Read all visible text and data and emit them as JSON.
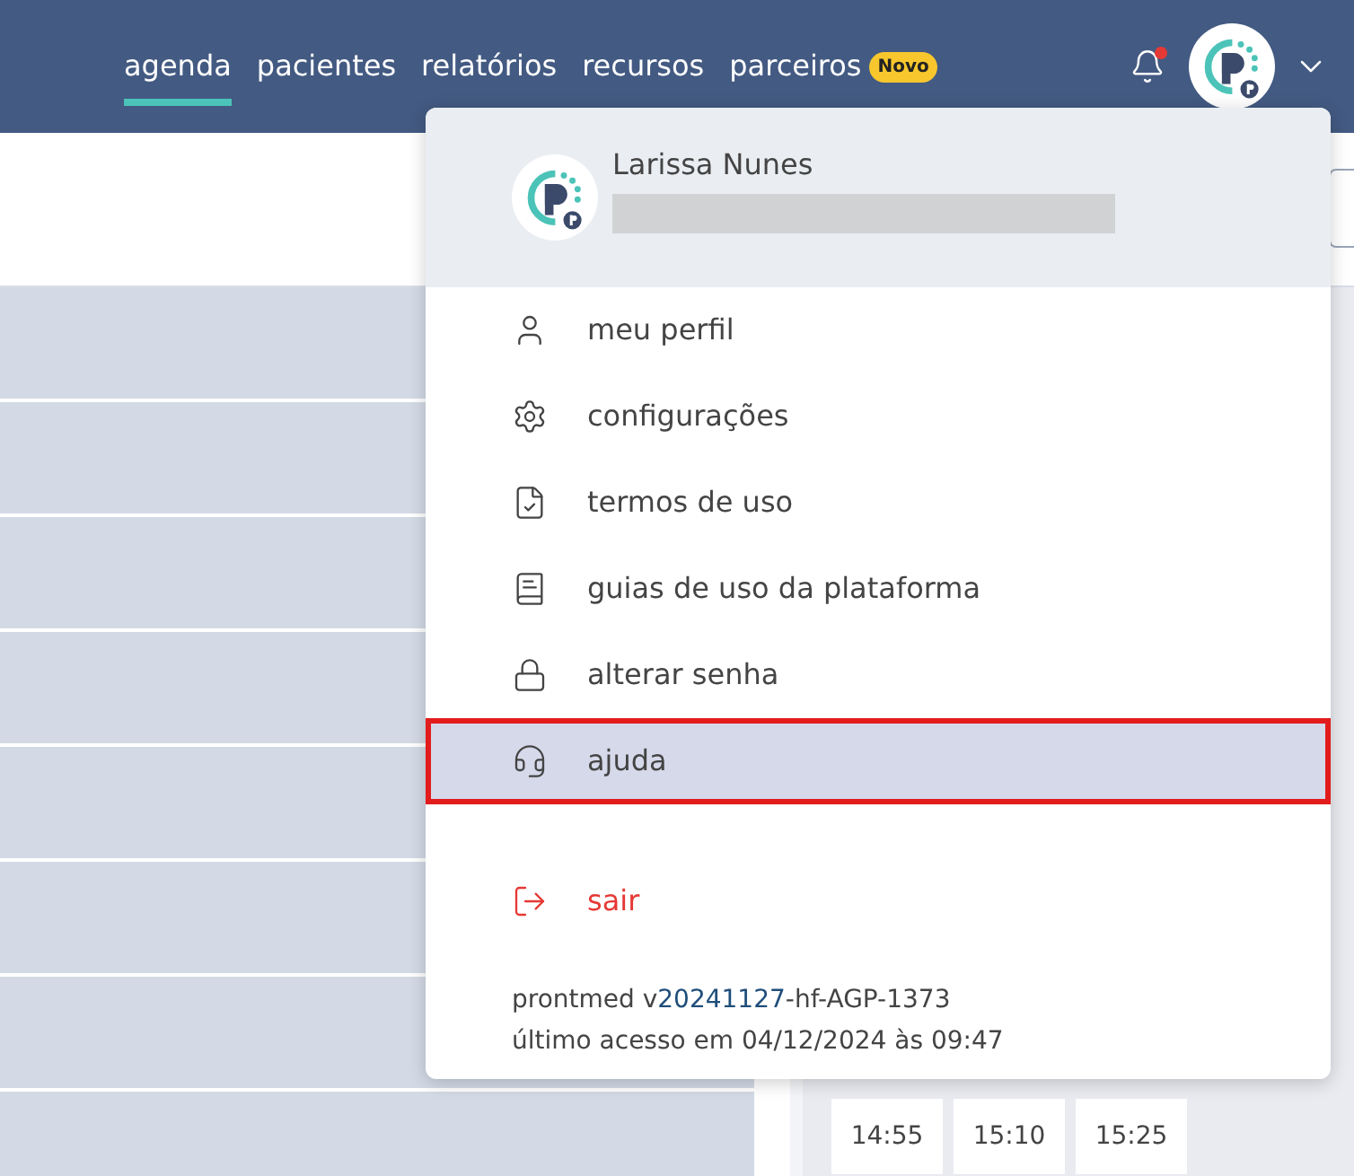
{
  "nav": {
    "items": [
      {
        "label": "agenda",
        "selected": true
      },
      {
        "label": "pacientes",
        "selected": false
      },
      {
        "label": "relatórios",
        "selected": false
      },
      {
        "label": "recursos",
        "selected": false
      },
      {
        "label": "parceiros",
        "selected": false,
        "badge": "Novo"
      }
    ],
    "notifications": {
      "unread": true
    }
  },
  "user_menu": {
    "name": "Larissa Nunes",
    "items": [
      {
        "label": "meu perfil",
        "selected": false,
        "kind": "normal"
      },
      {
        "label": "configurações",
        "selected": false,
        "kind": "normal"
      },
      {
        "label": "termos de uso",
        "selected": false,
        "kind": "normal"
      },
      {
        "label": "guias de uso da plataforma",
        "selected": false,
        "kind": "normal"
      },
      {
        "label": "alterar senha",
        "selected": false,
        "kind": "normal"
      },
      {
        "label": "ajuda",
        "selected": true,
        "kind": "normal"
      },
      {
        "label": "sair",
        "selected": false,
        "kind": "danger"
      }
    ],
    "version": {
      "prefix": "prontmed v",
      "build": "20241127",
      "suffix": "-hf-AGP-1373"
    },
    "last_access": "último acesso em 04/12/2024 às 09:47"
  },
  "time_slots": [
    {
      "label": "14:55"
    },
    {
      "label": "15:10"
    },
    {
      "label": "15:25"
    }
  ]
}
